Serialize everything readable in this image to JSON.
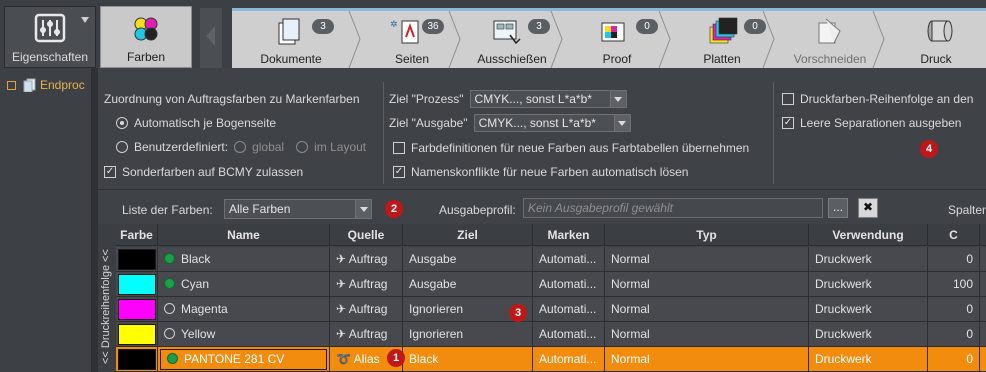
{
  "toolbar": {
    "eigenschaften_label": "Eigenschaften",
    "farben_label": "Farben",
    "steps": [
      {
        "label": "Dokumente",
        "count": "3"
      },
      {
        "label": "Seiten",
        "count": "36"
      },
      {
        "label": "Ausschießen",
        "count": "3"
      },
      {
        "label": "Proof",
        "count": "0"
      },
      {
        "label": "Platten",
        "count": "0"
      },
      {
        "label": "Vorschneiden",
        "count": ""
      },
      {
        "label": "Druck",
        "count": ""
      }
    ]
  },
  "tree": {
    "item_label": "Endproc"
  },
  "options": {
    "zuordnung_title": "Zuordnung von Auftragsfarben zu Markenfarben",
    "auto_label": "Automatisch je Bogenseite",
    "benutzer_label": "Benutzerdefiniert:",
    "global_label": "global",
    "layout_label": "im Layout",
    "sonderfarben_label": "Sonderfarben auf BCMY zulassen",
    "ziel_prozess_label": "Ziel \"Prozess\"",
    "ziel_prozess_value": "CMYK..., sonst L*a*b*",
    "ziel_ausgabe_label": "Ziel \"Ausgabe\"",
    "ziel_ausgabe_value": "CMYK..., sonst L*a*b*",
    "farbdef_label": "Farbdefinitionen für neue Farben aus Farbtabellen übernehmen",
    "namens_label": "Namenskonflikte für neue Farben automatisch lösen",
    "reihenfolge_label": "Druckfarben-Reihenfolge an den",
    "leere_label": "Leere Separationen ausgeben"
  },
  "filter": {
    "liste_label": "Liste der Farben:",
    "liste_value": "Alle Farben",
    "profil_label": "Ausgabeprofil:",
    "profil_placeholder": "Kein Ausgabeprofil gewählt",
    "more_label": "...",
    "clear_label": "✖",
    "spalten_label": "Spalten"
  },
  "badges": [
    "1",
    "2",
    "3",
    "4"
  ],
  "side_tab_label": "<< Druckreihenfolge <<",
  "table": {
    "headers": [
      "Farbe",
      "Name",
      "Quelle",
      "Ziel",
      "Marken",
      "Typ",
      "Verwendung",
      "C"
    ],
    "rows": [
      {
        "color": "#000000",
        "dot": "green",
        "name": "Black",
        "quelle": "Auftrag",
        "ziel": "Ausgabe",
        "marken": "Automati...",
        "typ": "Normal",
        "verwendung": "Druckwerk",
        "c": "0"
      },
      {
        "color": "#00ffff",
        "dot": "green",
        "name": "Cyan",
        "quelle": "Auftrag",
        "ziel": "Ausgabe",
        "marken": "Automati...",
        "typ": "Normal",
        "verwendung": "Druckwerk",
        "c": "100"
      },
      {
        "color": "#ff00ff",
        "dot": "empty",
        "name": "Magenta",
        "quelle": "Auftrag",
        "ziel": "Ignorieren",
        "marken": "Automati...",
        "typ": "Normal",
        "verwendung": "Druckwerk",
        "c": "0"
      },
      {
        "color": "#ffff00",
        "dot": "empty",
        "name": "Yellow",
        "quelle": "Auftrag",
        "ziel": "Ignorieren",
        "marken": "Automati...",
        "typ": "Normal",
        "verwendung": "Druckwerk",
        "c": "0"
      },
      {
        "color": "#000000",
        "dot": "green",
        "name": "PANTONE 281 CV",
        "quelle": "Alias",
        "ziel": "Black",
        "marken": "Automati...",
        "typ": "Normal",
        "verwendung": "Druckwerk",
        "c": "0"
      }
    ]
  },
  "colors": {
    "accent_orange": "#f28c0f",
    "badge_red": "#c01818",
    "status_green": "#1e9e4a"
  }
}
